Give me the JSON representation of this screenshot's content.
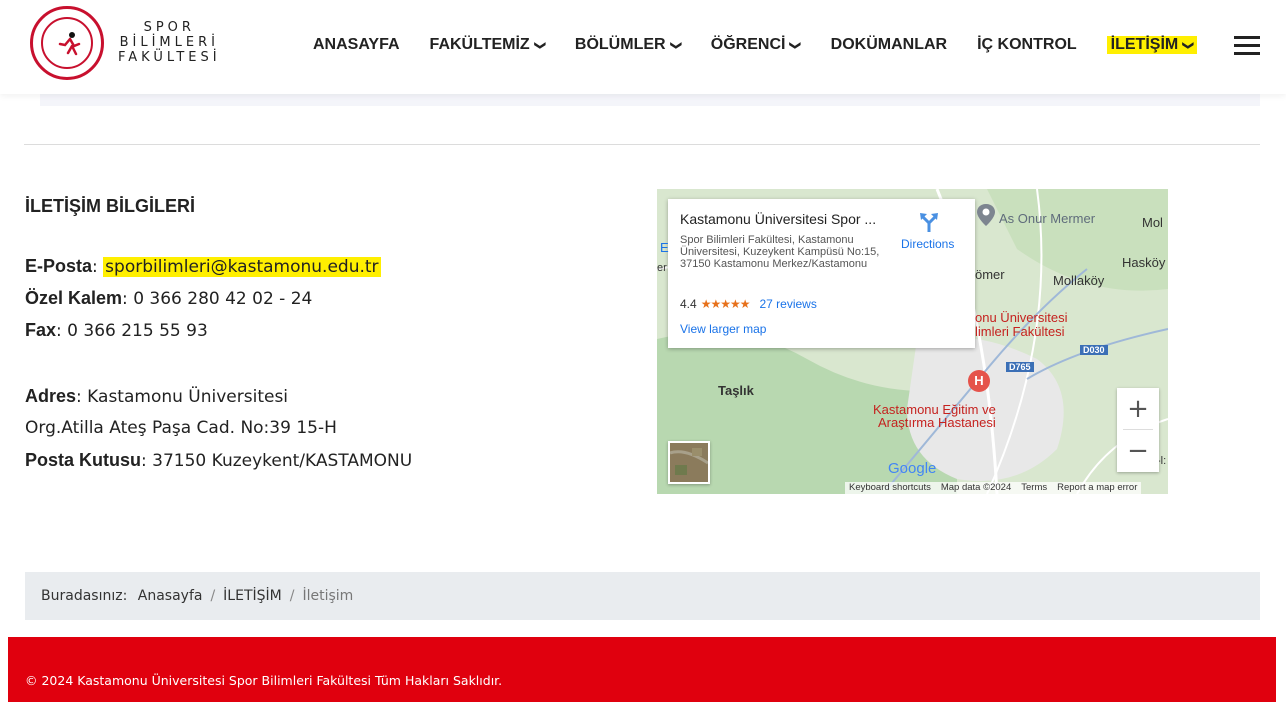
{
  "brand": {
    "line1": "SPOR",
    "line2": "BİLİMLERİ",
    "line3": "FAKÜLTESİ"
  },
  "nav": {
    "items": [
      {
        "label": "ANASAYFA",
        "dropdown": false
      },
      {
        "label": "FAKÜLTEMİZ",
        "dropdown": true
      },
      {
        "label": "BÖLÜMLER",
        "dropdown": true
      },
      {
        "label": "ÖĞRENCİ",
        "dropdown": true
      },
      {
        "label": "DOKÜMANLAR",
        "dropdown": false
      },
      {
        "label": "İÇ KONTROL",
        "dropdown": false
      },
      {
        "label": "İLETİŞİM",
        "dropdown": true,
        "highlighted": true
      }
    ],
    "chevron": "⌄",
    "menu_icon": "hamburger-icon"
  },
  "contact": {
    "heading": "İLETİŞİM BİLGİLERİ",
    "email_label": "E-Posta",
    "email_value": "sporbilimleri@kastamonu.edu.tr",
    "office_label": "Özel Kalem",
    "office_value": "0 366 280 42 02 - 24",
    "fax_label": "Fax",
    "fax_value": "0 366 215 55 93",
    "address_label": "Adres",
    "address_line1": "Kastamonu Üniversitesi",
    "address_line2": "Org.Atilla Ateş Paşa Cad. No:39 15-H",
    "pobox_label": "Posta Kutusu",
    "pobox_value": "37150 Kuzeykent/KASTAMONU",
    "separator": ": "
  },
  "map": {
    "card_title": "Kastamonu Üniversitesi Spor ...",
    "card_address": "Spor Bilimleri Fakültesi, Kastamonu Üniversitesi, Kuzeykent Kampüsü No:15, 37150 Kastamonu Merkez/Kastamonu",
    "rating": "4.4",
    "stars": "★★★★★",
    "reviews": "27 reviews",
    "directions": "Directions",
    "larger_map": "View larger map",
    "labels": {
      "as_onur": "As Onur Mermer",
      "mol": "Mol",
      "haskoy": "Hasköy",
      "omer": "ömer",
      "mollakoy": "Mollaköy",
      "uni1": "onu Üniversitesi",
      "uni2": "limleri Fakültesi",
      "taslik": "Taşlık",
      "hosp1": "Kastamonu Eğitim ve",
      "hosp2": "Araştırma Hastanesi",
      "edge_e": "E",
      "edge_er": "er",
      "edge_h": "-l:"
    },
    "roads": {
      "d030": "D030",
      "d765": "D765"
    },
    "hospital_marker": "H",
    "google": "Google",
    "zoom_in": "+",
    "zoom_out": "−",
    "attribution": {
      "shortcuts": "Keyboard shortcuts",
      "data": "Map data ©2024",
      "terms": "Terms",
      "report": "Report a map error"
    }
  },
  "breadcrumb": {
    "prefix": "Buradasınız:",
    "items": [
      "Anasayfa",
      "İLETİŞİM",
      "İletişim"
    ],
    "separator": "/"
  },
  "footer": {
    "text": "© 2024 Kastamonu Üniversitesi Spor Bilimleri Fakültesi Tüm Hakları Saklıdır."
  },
  "colors": {
    "accent_red": "#e0000e",
    "highlight": "#ffef00",
    "link_blue": "#1a73e8"
  }
}
